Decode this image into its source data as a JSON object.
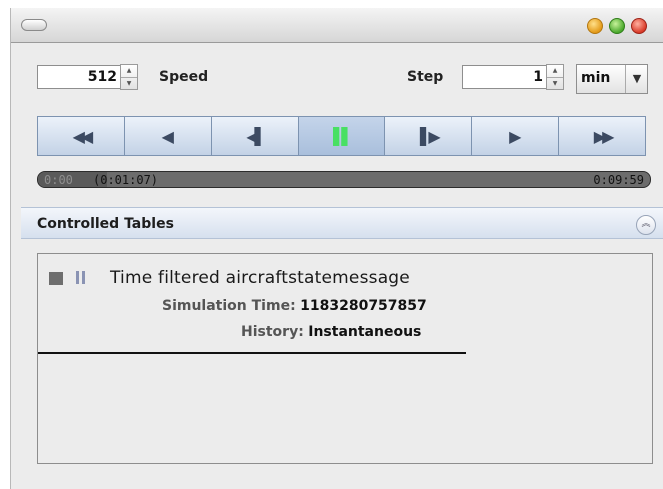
{
  "window": {
    "controls": [
      "minimize-icon",
      "zoom-icon",
      "close-icon"
    ]
  },
  "controls": {
    "speed_value": "512",
    "speed_label": "Speed",
    "step_label": "Step",
    "step_value": "1",
    "step_unit": "min"
  },
  "transport": {
    "buttons": [
      {
        "name": "rewind-to-start",
        "glyph": "◀◀"
      },
      {
        "name": "play-backward",
        "glyph": "◀"
      },
      {
        "name": "step-backward",
        "glyph": "◀▌"
      },
      {
        "name": "pause",
        "glyph": "▌▌",
        "active": true
      },
      {
        "name": "step-forward",
        "glyph": "▌▶"
      },
      {
        "name": "play-forward",
        "glyph": "▶"
      },
      {
        "name": "fast-forward-to-end",
        "glyph": "▶▶"
      }
    ]
  },
  "progress": {
    "start_time": "0:00",
    "current_time": "(0:01:07)",
    "end_time": "0:09:59",
    "fraction": 0.112
  },
  "panel": {
    "title": "Controlled Tables",
    "table": {
      "name": "Time filtered aircraftstatemessage",
      "sim_time_label": "Simulation Time:",
      "sim_time_value": "1183280757857",
      "history_label": "History:",
      "history_value": "Instantaneous"
    }
  },
  "colors": {
    "transport_active": "#48e063",
    "header_accent": "#d6e0ee"
  }
}
